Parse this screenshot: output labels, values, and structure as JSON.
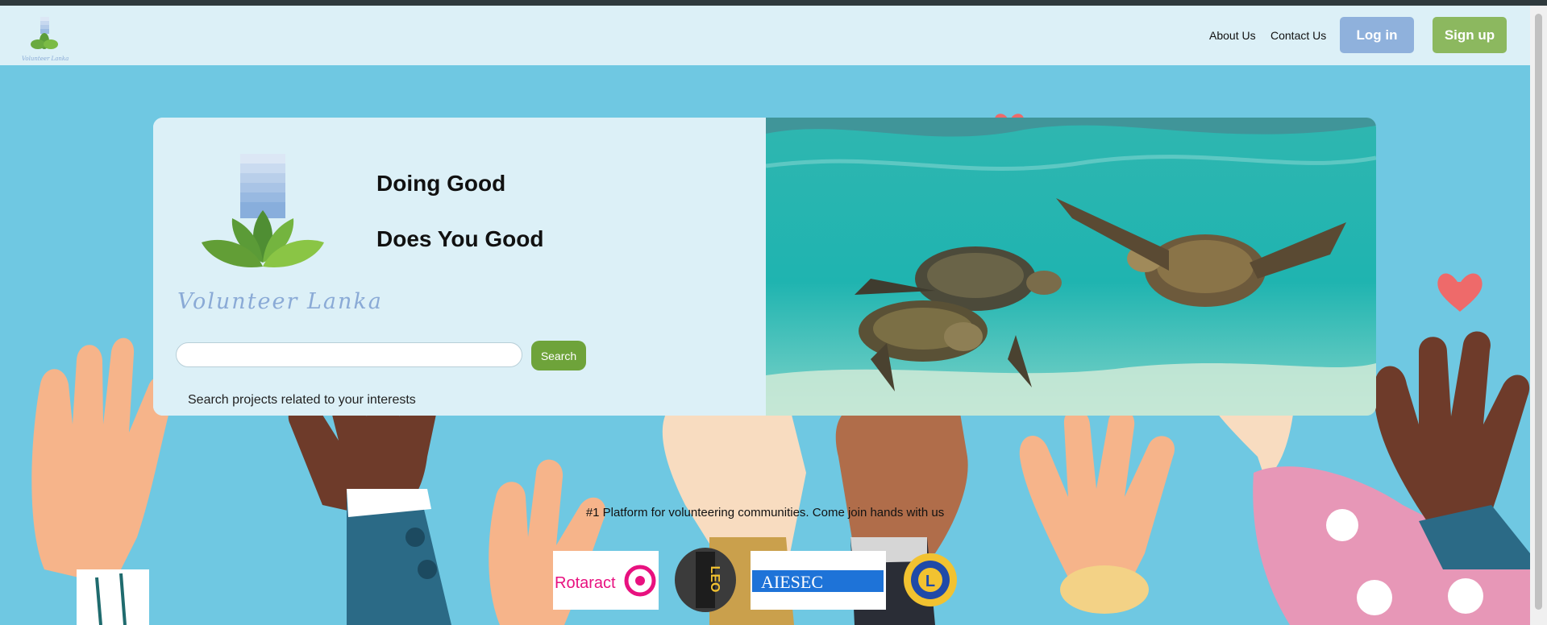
{
  "brand": {
    "name": "Volunteer Lanka"
  },
  "nav": {
    "links": [
      {
        "label": "About Us"
      },
      {
        "label": "Contact Us"
      }
    ],
    "login_label": "Log in",
    "signup_label": "Sign up"
  },
  "hero": {
    "headline_1": "Doing Good",
    "headline_2": "Does You Good",
    "search_button_label": "Search",
    "search_placeholder": "",
    "search_hint": "Search projects related to your interests"
  },
  "partners": {
    "tagline": "#1 Platform for volunteering communities. Come join hands with us",
    "logos": [
      {
        "name": "Rotaract",
        "text": "Rotaract",
        "color": "#e8117f"
      },
      {
        "name": "LEO",
        "text": "LEO",
        "color": "#f2c230"
      },
      {
        "name": "AIESEC",
        "text": "AIESEC",
        "color": "#1e73d8"
      },
      {
        "name": "Lions",
        "text": "L",
        "color": "#1f4aa8"
      }
    ]
  },
  "colors": {
    "background": "#6fc8e2",
    "nav_background": "#dcf0f7",
    "login_button": "#8fb1dc",
    "signup_button": "#8cb85f",
    "search_button": "#6ea33a",
    "brand_text": "#8aaad6"
  }
}
